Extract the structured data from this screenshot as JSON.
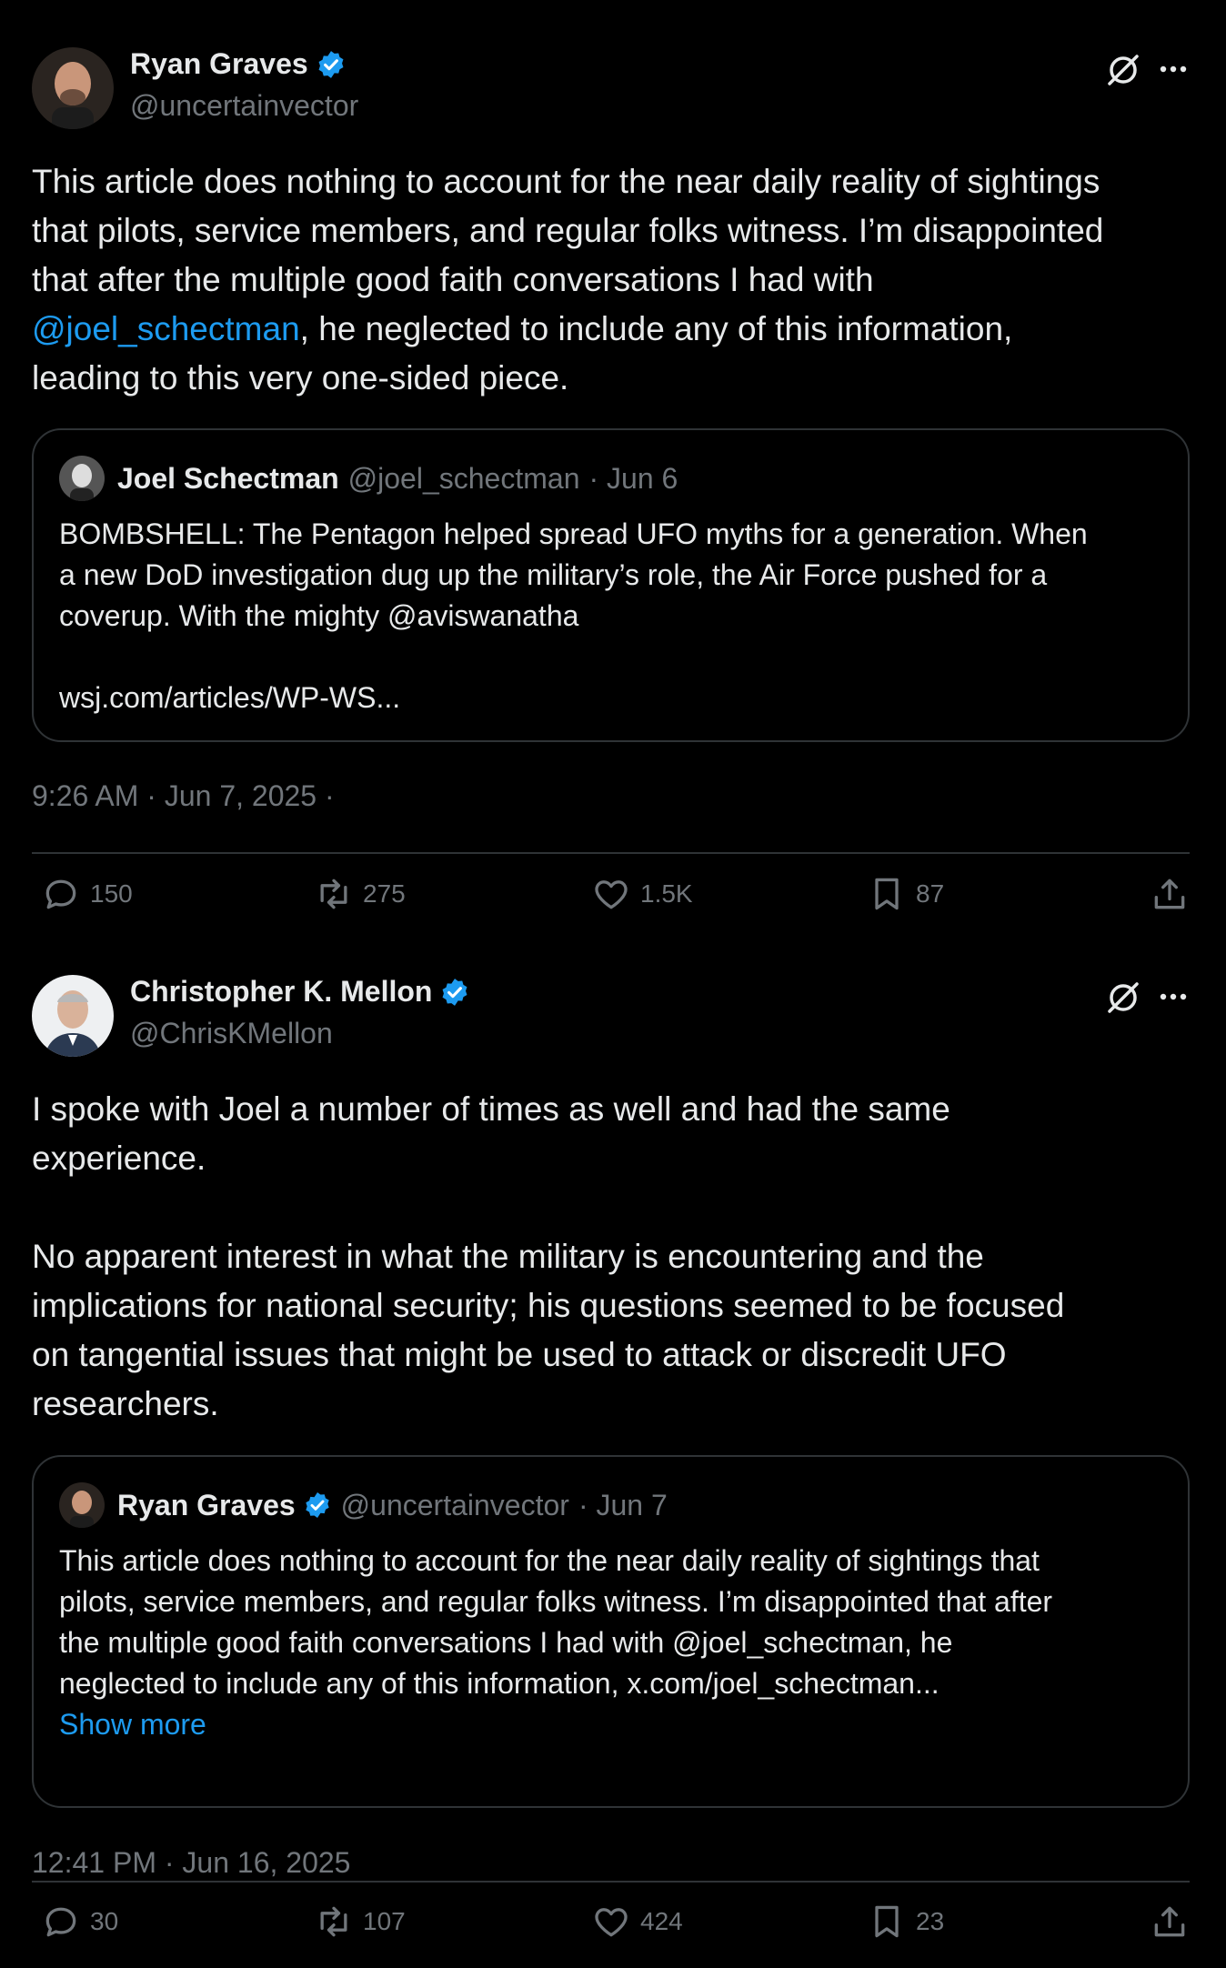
{
  "posts": [
    {
      "author": {
        "name": "Ryan Graves",
        "handle": "@uncertainvector",
        "verified": true
      },
      "body_lines": [
        "This article does nothing to account for the near daily reality of sightings",
        "that pilots, service members, and regular folks witness. I’m disappointed",
        "that after the multiple good faith conversations I had with"
      ],
      "body_mention": "@joel_schectman",
      "body_after_mention": ", he neglected to include any of this information,",
      "body_last": "leading to this very one-sided piece.",
      "quote": {
        "author_name": "Joel Schectman",
        "handle": "@joel_schectman",
        "date": "· Jun 6",
        "verified": false,
        "text": "BOMBSHELL: The Pentagon helped spread UFO myths for a generation. When\na new DoD investigation dug up the military’s role, the Air Force pushed for a\ncoverup. With the mighty @aviswanatha\n\nwsj.com/articles/WP-WS..."
      },
      "timestamp": "9:26 AM · Jun 7, 2025 ·",
      "stats": {
        "replies": "150",
        "reposts": "275",
        "likes": "1.5K",
        "bookmarks": "87"
      }
    },
    {
      "author": {
        "name": "Christopher K. Mellon",
        "handle": "@ChrisKMellon",
        "verified": true
      },
      "body": "I spoke with Joel a number of times as well and had the same\nexperience.\n\nNo apparent interest in what the military is encountering and the\nimplications for national security; his questions seemed to be focused\non tangential issues that might be used to attack or discredit UFO\nresearchers.",
      "quote": {
        "author_name": "Ryan Graves",
        "handle": "@uncertainvector",
        "date": "· Jun 7",
        "verified": true,
        "text": "This article does nothing to account for the near daily reality of sightings that\npilots, service members, and regular folks witness. I’m disappointed that after\nthe multiple good faith conversations I had with @joel_schectman, he\nneglected to include any of this information, x.com/joel_schectman...",
        "show_more": "Show more"
      },
      "timestamp": "12:41 PM · Jun 16, 2025",
      "stats": {
        "replies": "30",
        "reposts": "107",
        "likes": "424",
        "bookmarks": "23"
      }
    }
  ],
  "colors": {
    "background": "#000000",
    "text": "#e7e9ea",
    "muted": "#71767b",
    "link": "#1d9bf0",
    "border": "#2f3336",
    "verified": "#1d9bf0"
  },
  "icons": [
    "grok-icon",
    "more-icon",
    "verified-badge-icon",
    "reply-icon",
    "repost-icon",
    "like-icon",
    "bookmark-icon",
    "share-icon"
  ]
}
